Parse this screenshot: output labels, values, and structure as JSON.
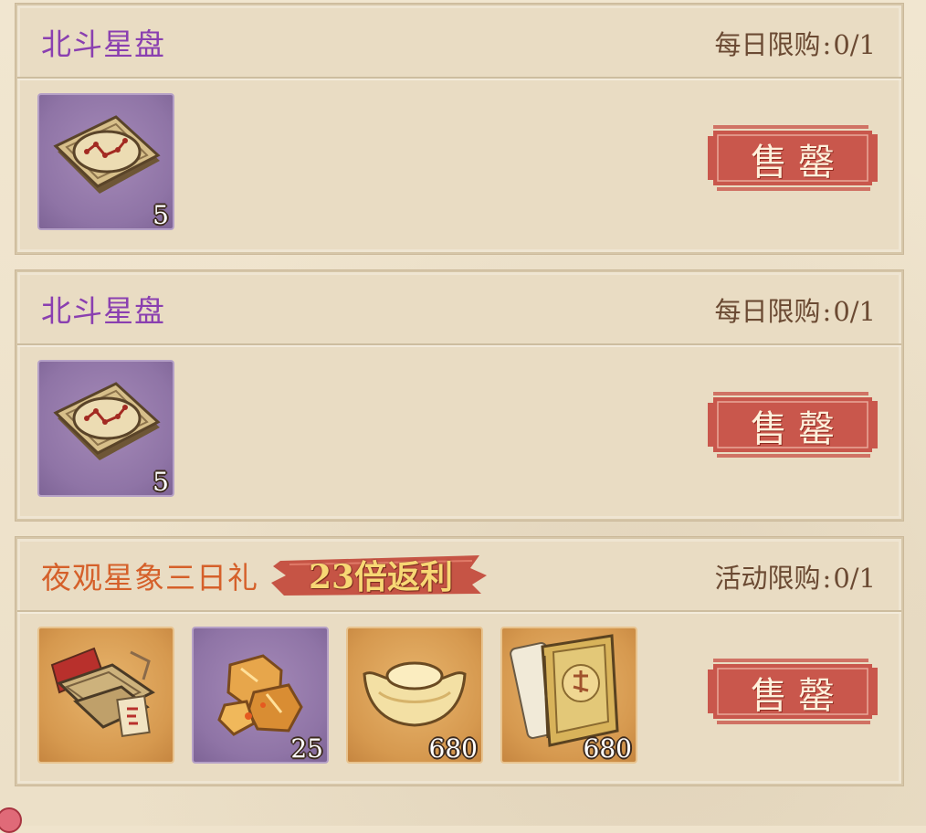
{
  "cards": [
    {
      "title": "北斗星盘",
      "limit_label": "每日限购",
      "limit_value": "0/1",
      "buy_label": "售罄",
      "items": [
        {
          "icon": "star-compass-icon",
          "qty": "5",
          "rarity": "purple"
        }
      ]
    },
    {
      "title": "北斗星盘",
      "limit_label": "每日限购",
      "limit_value": "0/1",
      "buy_label": "售罄",
      "items": [
        {
          "icon": "star-compass-icon",
          "qty": "5",
          "rarity": "purple"
        }
      ]
    },
    {
      "title": "夜观星象三日礼",
      "tag": "23倍返利",
      "limit_label": "活动限购",
      "limit_value": "0/1",
      "buy_label": "售罄",
      "items": [
        {
          "icon": "treasure-box-icon",
          "qty": "",
          "rarity": "gold"
        },
        {
          "icon": "gold-ore-icon",
          "qty": "25",
          "rarity": "purple"
        },
        {
          "icon": "gold-ingot-icon",
          "qty": "680",
          "rarity": "gold"
        },
        {
          "icon": "book-scroll-icon",
          "qty": "680",
          "rarity": "gold"
        }
      ]
    }
  ],
  "colors": {
    "title_purple": "#8a3fb0",
    "title_orange": "#d5602a",
    "soldout_red": "#c9574c"
  }
}
